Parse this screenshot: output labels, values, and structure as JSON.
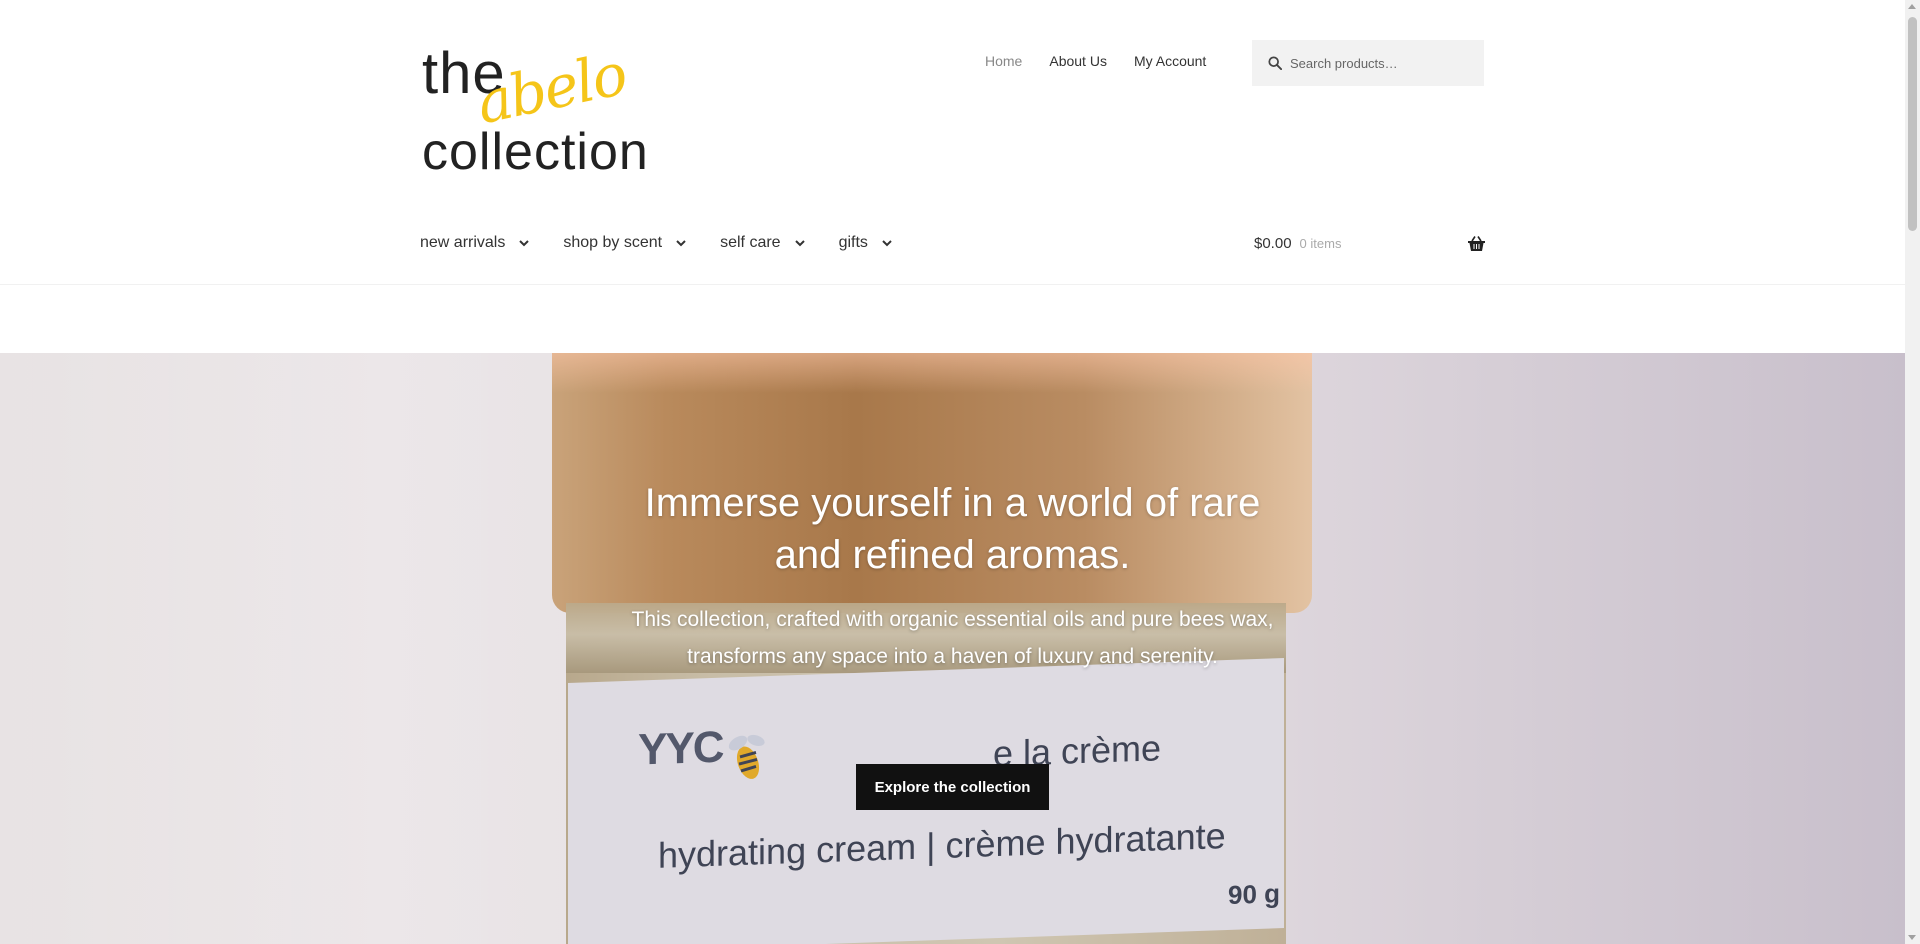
{
  "logo": {
    "line1": "the",
    "line2": "abelo",
    "line3": "collection",
    "accent_color": "#f5c519"
  },
  "secondary_nav": {
    "home": "Home",
    "about": "About Us",
    "account": "My Account"
  },
  "search": {
    "placeholder": "Search products…"
  },
  "primary_nav": {
    "items": [
      {
        "label": "new arrivals"
      },
      {
        "label": "shop by scent"
      },
      {
        "label": "self care"
      },
      {
        "label": "gifts"
      }
    ]
  },
  "cart": {
    "amount": "$0.00",
    "count": "0 items"
  },
  "hero": {
    "title": "Immerse yourself in a world of rare and refined aromas.",
    "subtitle": "This collection, crafted with organic essential oils and pure bees wax, transforms any space into a haven of luxury and serenity.",
    "button": "Explore the collection",
    "product_label": {
      "brand": "YYC",
      "name": "e la crème",
      "description": "hydrating cream | crème hydratante",
      "weight": "90 g"
    }
  }
}
